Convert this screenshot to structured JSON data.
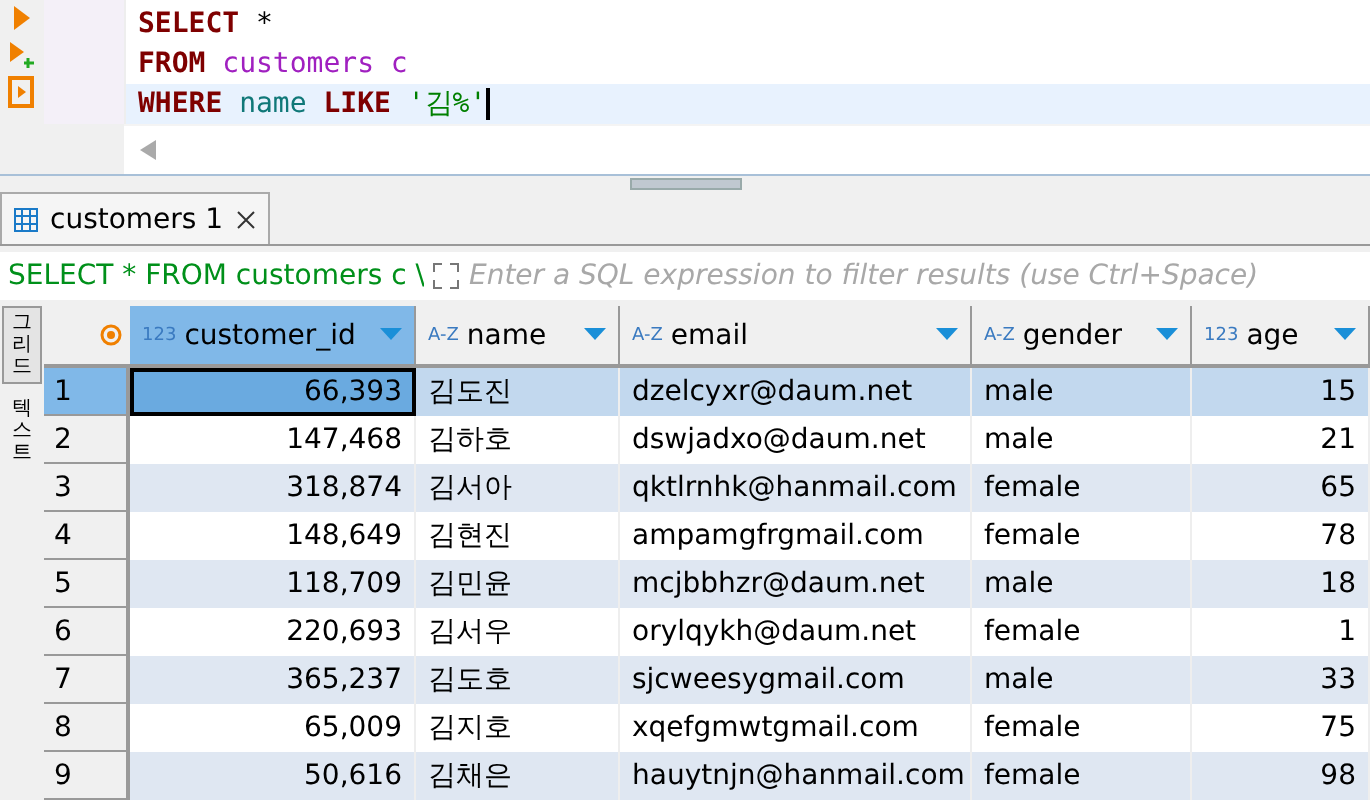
{
  "editor": {
    "lines": [
      {
        "current": false,
        "tokens": [
          {
            "kind": "keyword",
            "text": "SELECT"
          },
          {
            "kind": "plain",
            "text": "*"
          }
        ]
      },
      {
        "current": false,
        "tokens": [
          {
            "kind": "keyword",
            "text": "FROM"
          },
          {
            "kind": "table",
            "text": "customers c"
          }
        ]
      },
      {
        "current": true,
        "tokens": [
          {
            "kind": "keyword",
            "text": "WHERE"
          },
          {
            "kind": "column",
            "text": "name"
          },
          {
            "kind": "keyword",
            "text": "LIKE"
          },
          {
            "kind": "string",
            "text": "'김%'"
          }
        ]
      }
    ]
  },
  "tabs": [
    {
      "label": "customers 1",
      "selected": true
    }
  ],
  "filter": {
    "query": "SELECT * FROM customers c \\",
    "placeholder": "Enter a SQL expression to filter results (use Ctrl+Space)"
  },
  "side_tabs": [
    {
      "label": "그리드",
      "selected": true
    },
    {
      "label": "텍스트",
      "selected": false
    }
  ],
  "table": {
    "columns": [
      {
        "name": "customer_id",
        "type_label": "123",
        "kind": "number",
        "selected": true
      },
      {
        "name": "name",
        "type_label": "A-Z",
        "kind": "text",
        "selected": false
      },
      {
        "name": "email",
        "type_label": "A-Z",
        "kind": "text",
        "selected": false
      },
      {
        "name": "gender",
        "type_label": "A-Z",
        "kind": "text",
        "selected": false
      },
      {
        "name": "age",
        "type_label": "123",
        "kind": "number",
        "selected": false
      }
    ],
    "rows": [
      {
        "n": "1",
        "selected": true,
        "cells": [
          "66,393",
          "김도진",
          "dzelcyxr@daum.net",
          "male",
          "15"
        ]
      },
      {
        "n": "2",
        "selected": false,
        "cells": [
          "147,468",
          "김하호",
          "dswjadxo@daum.net",
          "male",
          "21"
        ]
      },
      {
        "n": "3",
        "selected": false,
        "cells": [
          "318,874",
          "김서아",
          "qktlrnhk@hanmail.com",
          "female",
          "65"
        ]
      },
      {
        "n": "4",
        "selected": false,
        "cells": [
          "148,649",
          "김현진",
          "ampamgfrgmail.com",
          "female",
          "78"
        ]
      },
      {
        "n": "5",
        "selected": false,
        "cells": [
          "118,709",
          "김민윤",
          "mcjbbhzr@daum.net",
          "male",
          "18"
        ]
      },
      {
        "n": "6",
        "selected": false,
        "cells": [
          "220,693",
          "김서우",
          "orylqykh@daum.net",
          "female",
          "1"
        ]
      },
      {
        "n": "7",
        "selected": false,
        "cells": [
          "365,237",
          "김도호",
          "sjcweesygmail.com",
          "male",
          "33"
        ]
      },
      {
        "n": "8",
        "selected": false,
        "cells": [
          "65,009",
          "김지호",
          "xqefgmwtgmail.com",
          "female",
          "75"
        ]
      },
      {
        "n": "9",
        "selected": false,
        "cells": [
          "50,616",
          "김채은",
          "hauytnjn@hanmail.com",
          "female",
          "98"
        ]
      }
    ]
  }
}
